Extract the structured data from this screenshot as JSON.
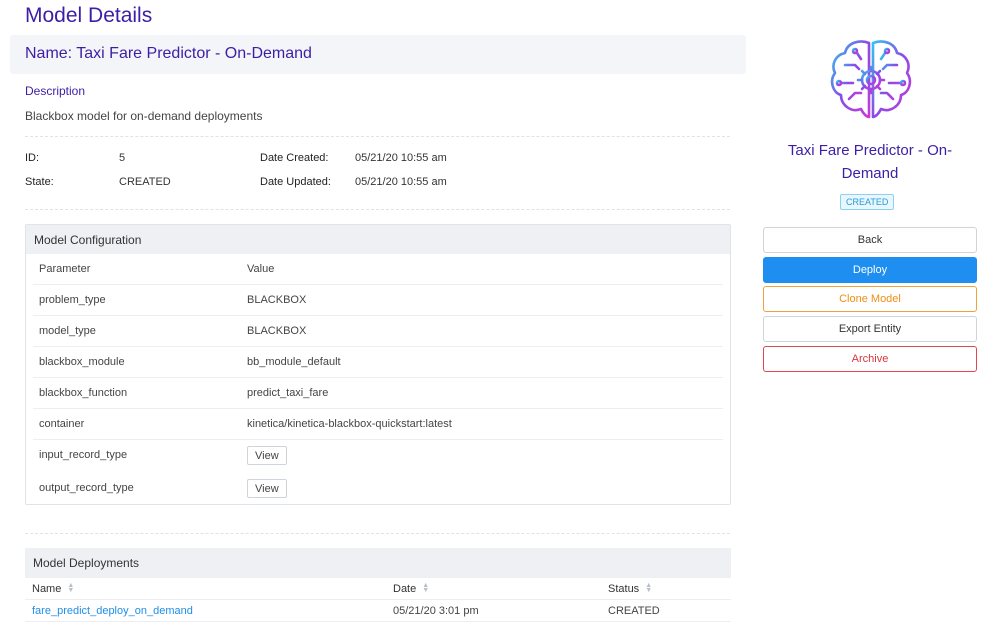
{
  "page_title": "Model Details",
  "name_bar": "Name: Taxi Fare Predictor - On-Demand",
  "description": {
    "label": "Description",
    "text": "Blackbox model for on-demand deployments"
  },
  "meta": {
    "id_label": "ID:",
    "id_value": "5",
    "state_label": "State:",
    "state_value": "CREATED",
    "created_label": "Date Created:",
    "created_value": "05/21/20 10:55 am",
    "updated_label": "Date Updated:",
    "updated_value": "05/21/20 10:55 am"
  },
  "config": {
    "title": "Model Configuration",
    "headers": [
      "Parameter",
      "Value"
    ],
    "rows": [
      {
        "param": "problem_type",
        "value": "BLACKBOX"
      },
      {
        "param": "model_type",
        "value": "BLACKBOX"
      },
      {
        "param": "blackbox_module",
        "value": "bb_module_default"
      },
      {
        "param": "blackbox_function",
        "value": "predict_taxi_fare"
      },
      {
        "param": "container",
        "value": "kinetica/kinetica-blackbox-quickstart:latest"
      },
      {
        "param": "input_record_type",
        "value": "View"
      },
      {
        "param": "output_record_type",
        "value": "View"
      }
    ]
  },
  "deployments": {
    "title": "Model Deployments",
    "headers": [
      "Name",
      "Date",
      "Status"
    ],
    "rows": [
      {
        "name": "fare_predict_deploy_on_demand",
        "date": "05/21/20 3:01 pm",
        "status": "CREATED"
      }
    ]
  },
  "side": {
    "icon": "brain-gear-icon",
    "title": "Taxi Fare Predictor - On-Demand",
    "badge": "CREATED",
    "buttons": {
      "back": "Back",
      "deploy": "Deploy",
      "clone": "Clone Model",
      "export": "Export Entity",
      "archive": "Archive"
    }
  },
  "colors": {
    "accent": "#3d1ea5",
    "primary": "#1e8ef0",
    "warning": "#ee8f16",
    "danger": "#d9363e",
    "link": "#1f8ee8"
  }
}
